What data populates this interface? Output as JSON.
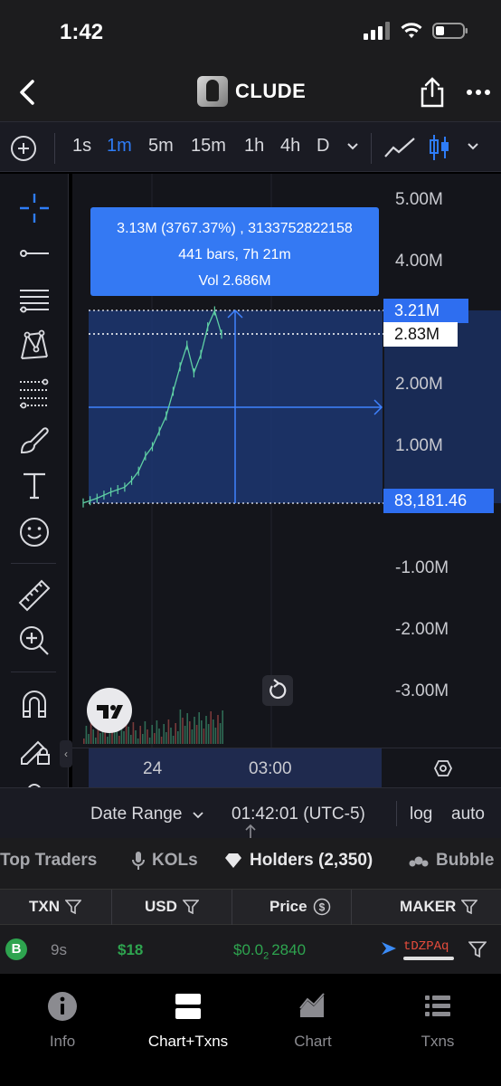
{
  "status": {
    "time": "1:42"
  },
  "nav": {
    "title": "CLUDE"
  },
  "timeframes": [
    "1s",
    "1m",
    "5m",
    "15m",
    "1h",
    "4h",
    "D"
  ],
  "active_timeframe": "1m",
  "measure": {
    "line1": "3.13M (3767.37%) , 3133752822158",
    "line2": "441 bars, 7h 21m",
    "line3": "Vol 2.686M"
  },
  "price_tags": {
    "top": "3.21M",
    "current": "2.83M",
    "bottom": "83,181.46"
  },
  "y_axis": [
    "5.00M",
    "4.00M",
    "2.00M",
    "1.00M",
    "-1.00M",
    "-2.00M",
    "-3.00M"
  ],
  "time_axis": {
    "day": "24",
    "time": "03:00"
  },
  "controls": {
    "date_range": "Date Range",
    "clock": "01:42:01 (UTC-5)",
    "log": "log",
    "auto": "auto"
  },
  "tabs": {
    "top_traders": "Top Traders",
    "kols": "KOLs",
    "holders": "Holders (2,350)",
    "bubble": "Bubble"
  },
  "table": {
    "headers": {
      "txn": "TXN",
      "usd": "USD",
      "price": "Price",
      "maker": "MAKER"
    },
    "row": {
      "type": "B",
      "age": "9s",
      "usd": "$18",
      "price_prefix": "$0.0",
      "price_zeros": "2",
      "price_digits": "2840",
      "maker": "tDZPAq"
    }
  },
  "bottom_nav": [
    "Info",
    "Chart+Txns",
    "Chart",
    "Txns"
  ],
  "colors": {
    "accent": "#2e7cf6",
    "buy": "#2ea44f",
    "up_candle": "#5fd0a4",
    "sell_address": "#e74c3c"
  },
  "chart_data": {
    "type": "line",
    "title": "",
    "xlabel": "",
    "ylabel": "",
    "ylim": [
      -3000000,
      5000000
    ],
    "x_ticks": [
      "24",
      "03:00"
    ],
    "series": [
      {
        "values": [
          83181,
          120000,
          160000,
          210000,
          260000,
          300000,
          340000,
          450000,
          600000,
          850000,
          1000000,
          1250000,
          1500000,
          1900000,
          2300000,
          2650000,
          2200000,
          2500000,
          2950000,
          3210000,
          2830000
        ]
      }
    ]
  }
}
